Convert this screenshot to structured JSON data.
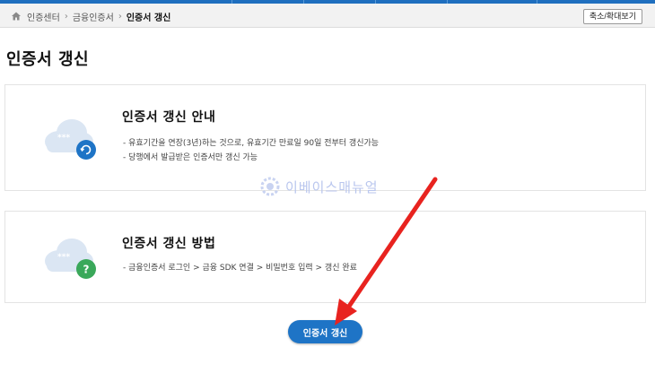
{
  "breadcrumb": {
    "items": [
      "인증센터",
      "금융인증서",
      "인증서 갱신"
    ],
    "separator": "›"
  },
  "toolbar": {
    "zoom_label": "축소/확대보기"
  },
  "page": {
    "title": "인증서 갱신"
  },
  "cards": [
    {
      "title": "인증서 갱신 안내",
      "lines": [
        "- 유효기간을 연장(3년)하는 것으로, 유효기간 만료일 90일 전부터 갱신가능",
        "- 당행에서 발급받은 인증서만 갱신 가능"
      ],
      "badge_icon": "refresh-icon",
      "badge_color": "#1e74c6",
      "cloud_stars": "***"
    },
    {
      "title": "인증서 갱신 방법",
      "lines": [
        "- 금융인증서 로그인 > 금융 SDK 연결 > 비밀번호 입력 > 갱신 완료"
      ],
      "badge_icon": "question-icon",
      "badge_glyph": "?",
      "badge_color": "#3aa85a",
      "cloud_stars": "***"
    }
  ],
  "watermark": {
    "text": "이베이스매뉴얼"
  },
  "action": {
    "renew_label": "인증서 갱신"
  },
  "colors": {
    "primary": "#1e74c6",
    "arrow": "#e8231f",
    "success": "#3aa85a"
  }
}
